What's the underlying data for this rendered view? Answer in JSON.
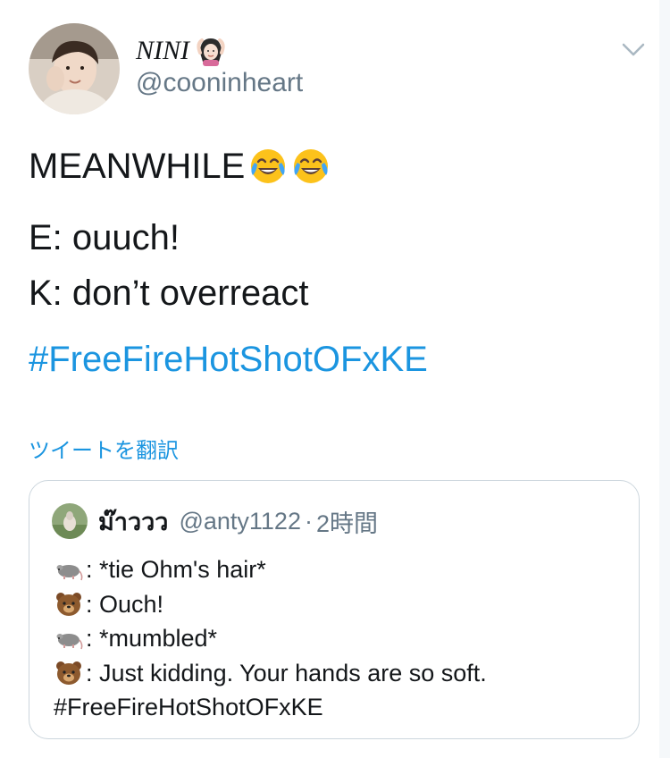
{
  "author": {
    "display_name": "NINI",
    "name_emoji": "woman-gesturing-ok-emoji",
    "handle": "@cooninheart"
  },
  "tweet": {
    "line1_text": "MEANWHILE",
    "line1_emojis": [
      "face-with-tears-of-joy-emoji",
      "face-with-tears-of-joy-emoji"
    ],
    "line2": "E: ouuch!",
    "line3": "K: don’t overreact",
    "hashtag": "#FreeFireHotShotOFxKE"
  },
  "translate_label": "ツイートを翻訳",
  "quoted_tweet": {
    "name": "ม๊าววว",
    "handle": "@anty1122",
    "separator": "·",
    "time": "2時間",
    "lines": [
      {
        "emoji": "rat-emoji",
        "text": ": *tie Ohm's hair*"
      },
      {
        "emoji": "bear-face-emoji",
        "text": ": Ouch!"
      },
      {
        "emoji": "rat-emoji",
        "text": ": *mumbled*"
      },
      {
        "emoji": "bear-face-emoji",
        "text": ": Just kidding. Your hands are so soft."
      }
    ],
    "hashtag": "#FreeFireHotShotOFxKE"
  },
  "colors": {
    "link_blue": "#1b95e0",
    "secondary_gray": "#657786",
    "text_dark": "#14171a",
    "border": "#ccd6dd"
  }
}
